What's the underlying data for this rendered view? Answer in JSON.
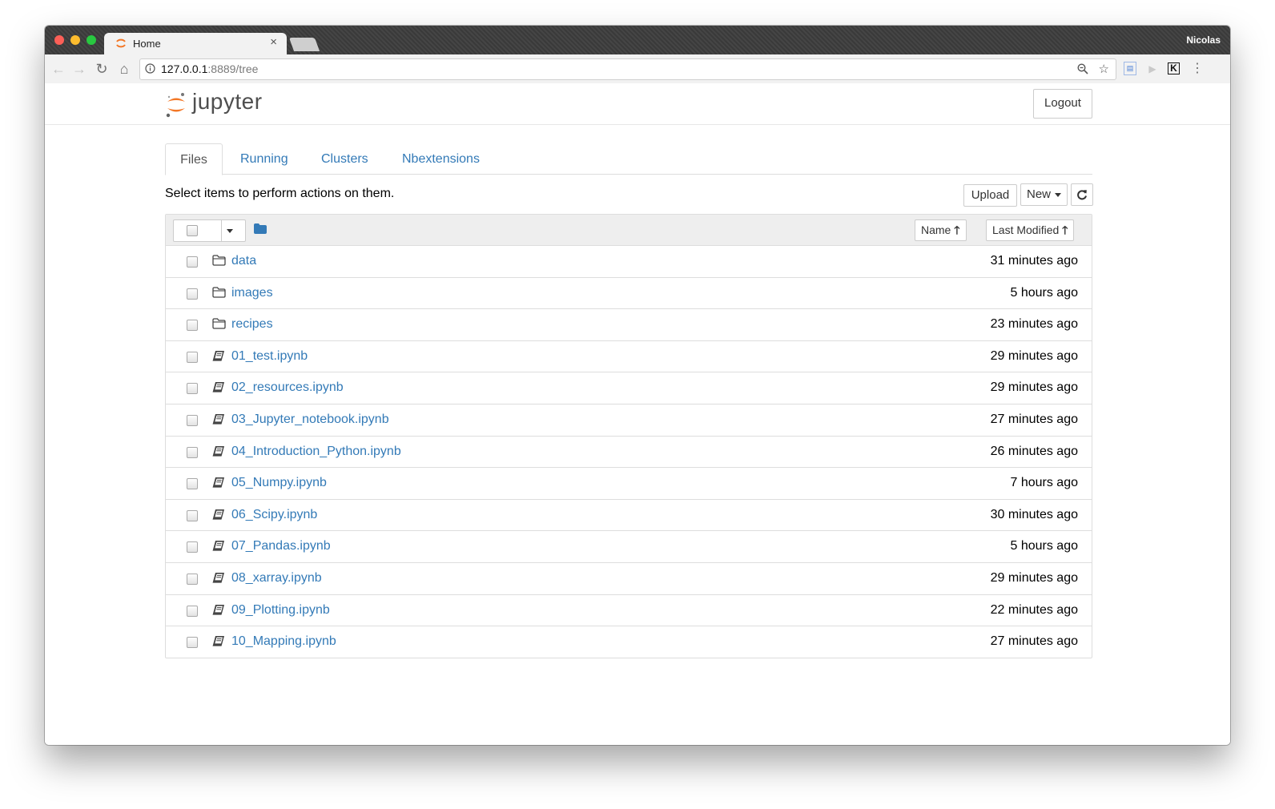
{
  "browser": {
    "tab_title": "Home",
    "tab_close": "×",
    "user": "Nicolas",
    "url_host": "127.0.0.1",
    "url_rest": ":8889/tree"
  },
  "header": {
    "logo_text": "jupyter",
    "logout_label": "Logout"
  },
  "tabs": [
    {
      "label": "Files",
      "active": true
    },
    {
      "label": "Running",
      "active": false
    },
    {
      "label": "Clusters",
      "active": false
    },
    {
      "label": "Nbextensions",
      "active": false
    }
  ],
  "toolbar": {
    "instructions": "Select items to perform actions on them.",
    "upload_label": "Upload",
    "new_label": "New",
    "refresh_icon": "refresh-icon"
  },
  "list_header": {
    "sort_name_label": "Name",
    "sort_modified_label": "Last Modified"
  },
  "files": [
    {
      "type": "folder",
      "name": "data",
      "modified": "31 minutes ago"
    },
    {
      "type": "folder",
      "name": "images",
      "modified": "5 hours ago"
    },
    {
      "type": "folder",
      "name": "recipes",
      "modified": "23 minutes ago"
    },
    {
      "type": "notebook",
      "name": "01_test.ipynb",
      "modified": "29 minutes ago"
    },
    {
      "type": "notebook",
      "name": "02_resources.ipynb",
      "modified": "29 minutes ago"
    },
    {
      "type": "notebook",
      "name": "03_Jupyter_notebook.ipynb",
      "modified": "27 minutes ago"
    },
    {
      "type": "notebook",
      "name": "04_Introduction_Python.ipynb",
      "modified": "26 minutes ago"
    },
    {
      "type": "notebook",
      "name": "05_Numpy.ipynb",
      "modified": "7 hours ago"
    },
    {
      "type": "notebook",
      "name": "06_Scipy.ipynb",
      "modified": "30 minutes ago"
    },
    {
      "type": "notebook",
      "name": "07_Pandas.ipynb",
      "modified": "5 hours ago"
    },
    {
      "type": "notebook",
      "name": "08_xarray.ipynb",
      "modified": "29 minutes ago"
    },
    {
      "type": "notebook",
      "name": "09_Plotting.ipynb",
      "modified": "22 minutes ago"
    },
    {
      "type": "notebook",
      "name": "10_Mapping.ipynb",
      "modified": "27 minutes ago"
    }
  ],
  "colors": {
    "link": "#337ab7",
    "jupyter_orange": "#f37726"
  }
}
